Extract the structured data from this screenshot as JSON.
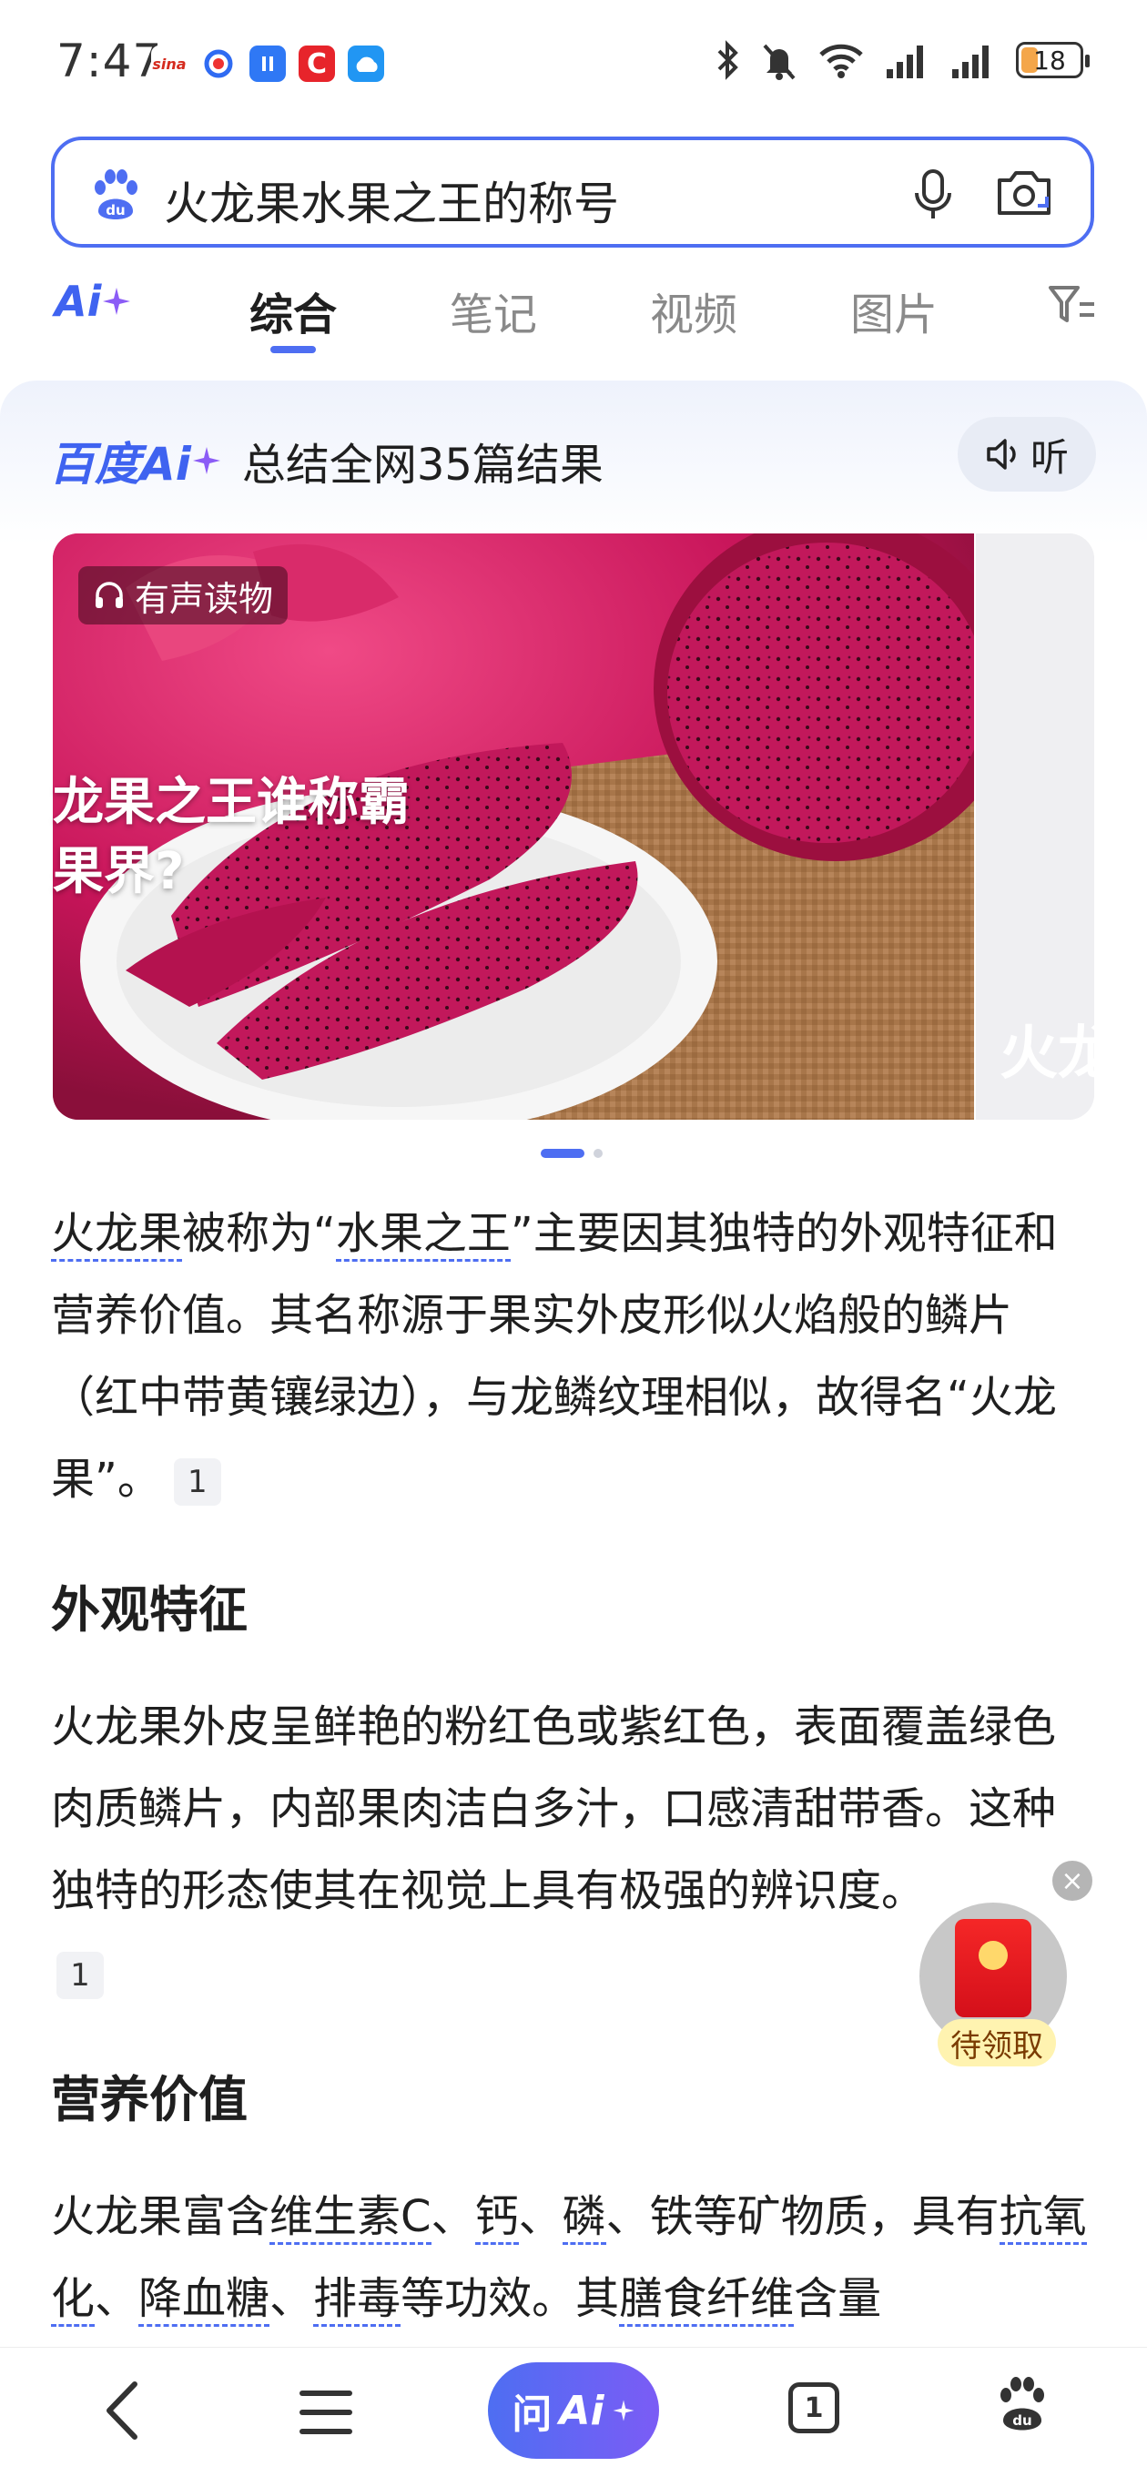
{
  "status_bar": {
    "time": "7:47",
    "battery": "18",
    "app_icons": [
      "sina-icon",
      "baidu-app-icon",
      "blue-app-icon",
      "red-c-app-icon",
      "cloud-app-icon"
    ],
    "system_icons": [
      "bluetooth-icon",
      "mute-icon",
      "wifi-icon",
      "signal-icon",
      "signal-icon"
    ]
  },
  "search": {
    "query": "火龙果水果之王的称号"
  },
  "tabs": {
    "ai_label": "Ai",
    "items": [
      "综合",
      "笔记",
      "视频",
      "图片"
    ],
    "active": "综合"
  },
  "ai_card": {
    "brand": "百度Ai",
    "summary": "总结全网35篇结果",
    "listen": "听",
    "carousel": {
      "badge": "有声读物",
      "caption_line1": "龙果之王谁称霸",
      "caption_line2": "果界?",
      "next_caption": "火龙"
    },
    "paragraph1": {
      "w1": "火龙果",
      "t1": "被称为“",
      "w2": "水果之王",
      "t2": "”主要因其独特的外观特征和营养价值。其名称源于果实外皮形似火焰般的鳞片（红中带黄镶绿边），与龙鳞纹理相似，故得名“火龙果”。",
      "ref": "1"
    },
    "heading1": "外观特征",
    "paragraph2": {
      "text": "火龙果外皮呈鲜艳的粉红色或紫红色，表面覆盖绿色肉质鳞片，内部果肉洁白多汁，口感清甜带香。这种独特的形态使其在视觉上具有极强的辨识度。",
      "ref": "1"
    },
    "heading2": "营养价值",
    "paragraph3": {
      "t1": "火龙果富含",
      "w1": "维生素C",
      "t2": "、",
      "w2": "钙",
      "t3": "、",
      "w3": "磷",
      "t4": "、铁等矿物质，具有",
      "w4": "抗氧化",
      "t5": "、",
      "w5": "降血糖",
      "t6": "、",
      "w6": "排毒",
      "t7": "等功效。其",
      "w7": "膳食纤维",
      "t8": "含量"
    }
  },
  "red_packet": {
    "label": "待领取"
  },
  "bottom_nav": {
    "ask": "问",
    "ask_ai": "Ai",
    "tab_count": "1"
  },
  "colors": {
    "accent": "#4e6ef2",
    "ai_gradient_end": "#7b5cf5",
    "packet_red": "#e8141f"
  }
}
